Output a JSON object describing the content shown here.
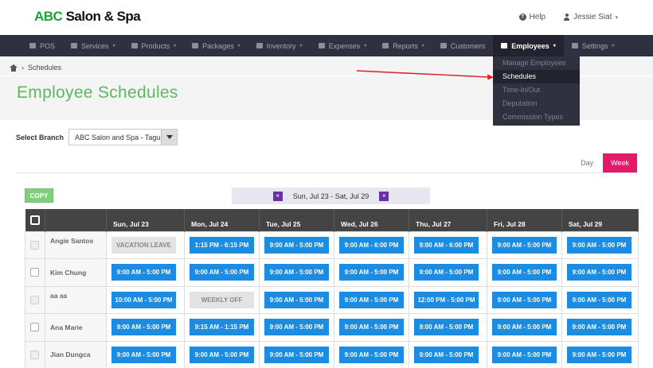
{
  "app": {
    "logo_abc": "ABC",
    "logo_rest": " Salon & Spa"
  },
  "topright": {
    "help": "Help",
    "user": "Jessie Siat"
  },
  "nav": [
    {
      "label": "POS",
      "icon": "pos-icon",
      "chev": false
    },
    {
      "label": "Services",
      "icon": "hand-icon",
      "chev": true
    },
    {
      "label": "Products",
      "icon": "tag-icon",
      "chev": true
    },
    {
      "label": "Packages",
      "icon": "tags-icon",
      "chev": true
    },
    {
      "label": "Inventory",
      "icon": "list-icon",
      "chev": true
    },
    {
      "label": "Expenses",
      "icon": "wallet-icon",
      "chev": true
    },
    {
      "label": "Reports",
      "icon": "chart-icon",
      "chev": true
    },
    {
      "label": "Customers",
      "icon": "users-icon",
      "chev": false
    },
    {
      "label": "Employees",
      "icon": "briefcase-icon",
      "chev": true,
      "active": true
    },
    {
      "label": "Settings",
      "icon": "gear-icon",
      "chev": true
    }
  ],
  "dropdown": [
    "Manage Employees",
    "Schedules",
    "Time-In/Out",
    "Deputation",
    "Commission Types"
  ],
  "breadcrumb": {
    "current": "Schedules"
  },
  "page_title": "Employee Schedules",
  "branch": {
    "label": "Select Branch",
    "value": "ABC Salon and Spa - Taguig"
  },
  "view": {
    "day": "Day",
    "week": "Week"
  },
  "copy_label": "COPY",
  "week_range": "Sun, Jul 23 - Sat, Jul 29",
  "days": [
    "Sun, Jul 23",
    "Mon, Jul 24",
    "Tue, Jul 25",
    "Wed, Jul 26",
    "Thu, Jul 27",
    "Fri, Jul 28",
    "Sat, Jul 29"
  ],
  "employees": [
    {
      "name": "Angie Santos",
      "slots": [
        "VACATION LEAVE",
        "1:15 PM - 6:15 PM",
        "9:00 AM - 5:00 PM",
        "9:00 AM - 6:00 PM",
        "9:00 AM - 6:00 PM",
        "9:00 AM - 5:00 PM",
        "9:00 AM - 5:00 PM"
      ]
    },
    {
      "name": "Kim Chung",
      "slots": [
        "9:00 AM - 5:00 PM",
        "9:00 AM - 5:00 PM",
        "9:00 AM - 5:00 PM",
        "9:00 AM - 5:00 PM",
        "9:00 AM - 5:00 PM",
        "9:00 AM - 5:00 PM",
        "9:00 AM - 5:00 PM"
      ]
    },
    {
      "name": "aa aa",
      "slots": [
        "10:00 AM - 5:00 PM",
        "WEEKLY OFF",
        "9:00 AM - 5:00 PM",
        "9:00 AM - 5:00 PM",
        "12:00 PM - 5:00 PM",
        "9:00 AM - 5:00 PM",
        "9:00 AM - 5:00 PM"
      ]
    },
    {
      "name": "Ana Marie",
      "slots": [
        "9:00 AM - 5:00 PM",
        "9:15 AM - 1:15 PM",
        "9:00 AM - 5:00 PM",
        "9:00 AM - 5:00 PM",
        "9:00 AM - 5:00 PM",
        "9:00 AM - 5:00 PM",
        "9:00 AM - 5:00 PM"
      ]
    },
    {
      "name": "Jian Dungca",
      "slots": [
        "9:00 AM - 5:00 PM",
        "9:00 AM - 5:00 PM",
        "9:00 AM - 5:00 PM",
        "9:00 AM - 5:00 PM",
        "9:00 AM - 5:00 PM",
        "9:00 AM - 5:00 PM",
        "9:00 AM - 5:00 PM"
      ]
    }
  ],
  "colors": {
    "accent_green": "#5cb85c",
    "nav_bg": "#2f3040",
    "slot_blue": "#1c8ce3",
    "week_pink": "#e5196b",
    "arrow_red": "#e02020"
  }
}
